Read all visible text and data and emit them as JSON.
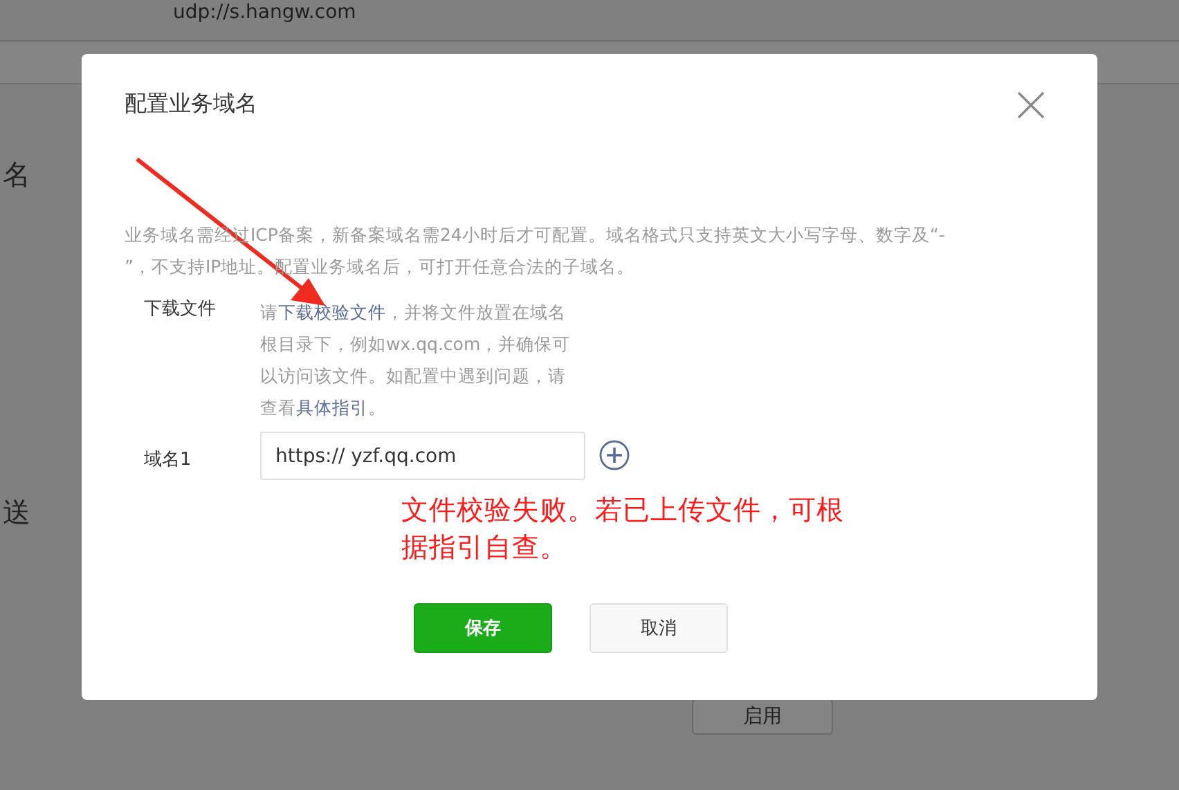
{
  "background": {
    "address": "udp://s.hangw.com",
    "section_1": "名",
    "section_2": "送",
    "enable_button": "启用"
  },
  "dialog": {
    "title": "配置业务域名",
    "description": "业务域名需经过ICP备案，新备案域名需24小时后才可配置。域名格式只支持英文大小写字母、数字及“- ”，不支持IP地址。配置业务域名后，可打开任意合法的子域名。",
    "download": {
      "label": "下载文件",
      "parts": [
        {
          "kind": "text",
          "text": "请"
        },
        {
          "kind": "link",
          "text": "下载校验文件"
        },
        {
          "kind": "text",
          "text": "，并将文件放置在域名根目录下，例如wx.qq.com，并确保可以访问该文件。如配置中遇到问题，请查看"
        },
        {
          "kind": "link",
          "text": "具体指引"
        },
        {
          "kind": "text",
          "text": "。"
        }
      ]
    },
    "domains": [
      {
        "label": "域名1",
        "value": "https:// yzf.qq.com"
      }
    ],
    "annotation": "文件校验失败。若已上传文件，可根据指引自查。",
    "buttons": [
      {
        "label": "保存",
        "kind": "primary"
      },
      {
        "label": "取消",
        "kind": "default"
      }
    ]
  }
}
